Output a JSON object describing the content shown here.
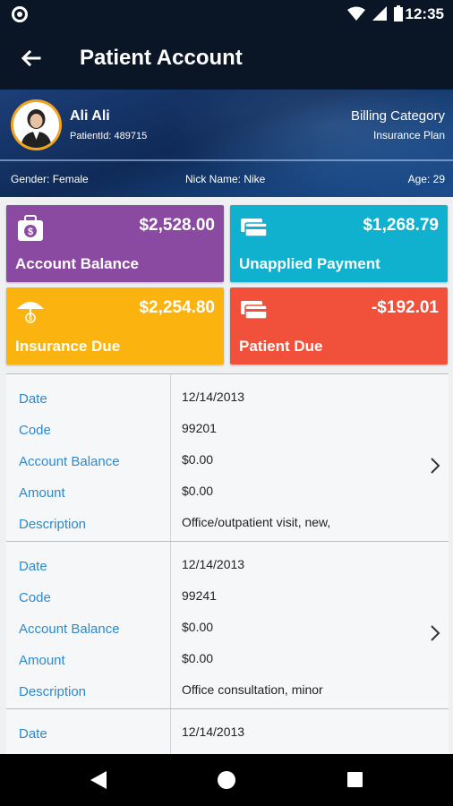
{
  "status_bar": {
    "time": "12:35"
  },
  "app_bar": {
    "title": "Patient Account"
  },
  "patient": {
    "name": "Ali  Ali",
    "patient_id": "PatientId: 489715",
    "billing_category": "Billing Category",
    "insurance_plan": "Insurance Plan",
    "gender": "Gender:  Female",
    "nick_name": "Nick Name:  Nike",
    "age": "Age:  29"
  },
  "cards": [
    {
      "label": "Account Balance",
      "amount": "$2,528.00",
      "color": "#8b4aa2",
      "icon": "money-bag-icon"
    },
    {
      "label": "Unapplied Payment",
      "amount": "$1,268.79",
      "color": "#0fb1cf",
      "icon": "card-stack-icon"
    },
    {
      "label": "Insurance Due",
      "amount": "$2,254.80",
      "color": "#fbb30f",
      "icon": "umbrella-icon"
    },
    {
      "label": "Patient Due",
      "amount": "-$192.01",
      "color": "#f1513a",
      "icon": "card-stack-icon"
    }
  ],
  "field_labels": {
    "date": "Date",
    "code": "Code",
    "account_balance": "Account Balance",
    "amount": "Amount",
    "description": "Description"
  },
  "transactions": [
    {
      "date": "12/14/2013",
      "code": "99201",
      "account_balance": "$0.00",
      "amount": "$0.00",
      "description": "Office/outpatient visit, new,"
    },
    {
      "date": "12/14/2013",
      "code": "99241",
      "account_balance": "$0.00",
      "amount": "$0.00",
      "description": "Office consultation, minor"
    },
    {
      "date": "12/14/2013"
    }
  ]
}
